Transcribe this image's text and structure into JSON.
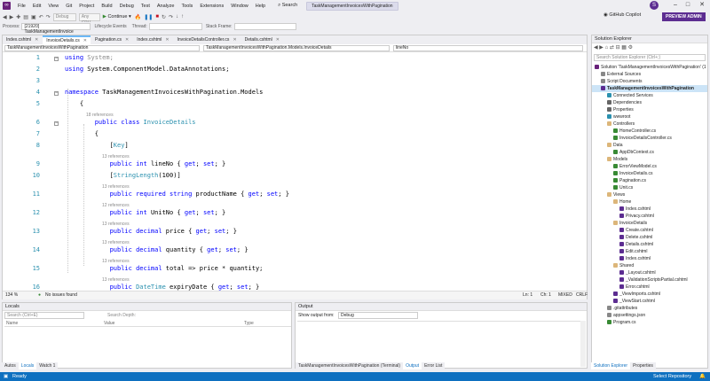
{
  "menubar": {
    "logo_icon": "visual-studio-logo-icon",
    "items": [
      "File",
      "Edit",
      "View",
      "Git",
      "Project",
      "Build",
      "Debug",
      "Test",
      "Analyze",
      "Tools",
      "Extensions",
      "Window",
      "Help"
    ],
    "search": "Search",
    "solution_name": "TaskManagementInvoicesWithPagination",
    "avatar": "S"
  },
  "toolbar": {
    "config": "Debug",
    "platform": "Any CPU",
    "run_label": "Continue",
    "copilot": "GitHub Copilot",
    "preview": "PREVIEW ADMIN"
  },
  "procbar": {
    "process_label": "Process:",
    "process_value": "[21920] TaskManagementInvoice",
    "lifecycle": "Lifecycle Events",
    "thread_label": "Thread:",
    "stack_label": "Stack Frame:"
  },
  "editor": {
    "tabs": [
      "Index.cshtml",
      "InvoiceDetails.cs",
      "Pagination.cs",
      "Index.cshtml",
      "InvoiceDetailsController.cs",
      "Details.cshtml"
    ],
    "active_tab": 1,
    "nav": [
      "TaskManagementInvoicesWithPagination",
      "TaskManagementInvoicesWithPagination.Models.InvoiceDetails",
      "lineNo"
    ],
    "lines": [
      {
        "n": "1",
        "parts": [
          [
            "kw",
            "using "
          ],
          [
            "cm",
            "System;"
          ]
        ]
      },
      {
        "n": "2",
        "parts": [
          [
            "kw",
            "using "
          ],
          [
            "",
            "System.ComponentModel.DataAnnotations;"
          ]
        ]
      },
      {
        "n": "3",
        "parts": []
      },
      {
        "n": "4",
        "parts": [
          [
            "kw",
            "namespace "
          ],
          [
            "",
            "TaskManagementInvoicesWithPagination.Models"
          ]
        ]
      },
      {
        "n": "5",
        "parts": [
          [
            "",
            "    {"
          ]
        ]
      },
      {
        "n": "",
        "ref": "18 references"
      },
      {
        "n": "6",
        "parts": [
          [
            "kw",
            "        public class "
          ],
          [
            "ty",
            "InvoiceDetails"
          ]
        ]
      },
      {
        "n": "7",
        "parts": [
          [
            "",
            "        {"
          ]
        ]
      },
      {
        "n": "8",
        "parts": [
          [
            "",
            "            ["
          ],
          [
            "ty",
            "Key"
          ],
          [
            "",
            "]"
          ]
        ]
      },
      {
        "n": "",
        "ref": "13 references"
      },
      {
        "n": "9",
        "parts": [
          [
            "kw",
            "            public int "
          ],
          [
            "",
            "lineNo { "
          ],
          [
            "kw",
            "get"
          ],
          [
            "",
            "; "
          ],
          [
            "kw",
            "set"
          ],
          [
            "",
            "; }"
          ]
        ]
      },
      {
        "n": "10",
        "parts": [
          [
            "",
            "            ["
          ],
          [
            "ty",
            "StringLength"
          ],
          [
            "",
            "(100)]"
          ]
        ]
      },
      {
        "n": "",
        "ref": "13 references"
      },
      {
        "n": "11",
        "parts": [
          [
            "kw",
            "            public required string "
          ],
          [
            "",
            "productName { "
          ],
          [
            "kw",
            "get"
          ],
          [
            "",
            "; "
          ],
          [
            "kw",
            "set"
          ],
          [
            "",
            "; }"
          ]
        ]
      },
      {
        "n": "",
        "ref": "12 references"
      },
      {
        "n": "12",
        "parts": [
          [
            "kw",
            "            public int "
          ],
          [
            "",
            "UnitNo { "
          ],
          [
            "kw",
            "get"
          ],
          [
            "",
            "; "
          ],
          [
            "kw",
            "set"
          ],
          [
            "",
            "; }"
          ]
        ]
      },
      {
        "n": "",
        "ref": "13 references"
      },
      {
        "n": "13",
        "parts": [
          [
            "kw",
            "            public decimal "
          ],
          [
            "",
            "price { "
          ],
          [
            "kw",
            "get"
          ],
          [
            "",
            "; "
          ],
          [
            "kw",
            "set"
          ],
          [
            "",
            "; }"
          ]
        ]
      },
      {
        "n": "",
        "ref": "13 references"
      },
      {
        "n": "14",
        "parts": [
          [
            "kw",
            "            public decimal "
          ],
          [
            "",
            "quantity { "
          ],
          [
            "kw",
            "get"
          ],
          [
            "",
            "; "
          ],
          [
            "kw",
            "set"
          ],
          [
            "",
            "; }"
          ]
        ]
      },
      {
        "n": "",
        "ref": "13 references"
      },
      {
        "n": "15",
        "parts": [
          [
            "kw",
            "            public decimal "
          ],
          [
            "",
            "total => price * quantity;"
          ]
        ]
      },
      {
        "n": "",
        "ref": "13 references"
      },
      {
        "n": "16",
        "parts": [
          [
            "kw",
            "            public "
          ],
          [
            "ty",
            "DateTime "
          ],
          [
            "",
            "expiryDate { "
          ],
          [
            "kw",
            "get"
          ],
          [
            "",
            "; "
          ],
          [
            "kw",
            "set"
          ],
          [
            "",
            "; }"
          ]
        ]
      },
      {
        "n": "17",
        "parts": []
      },
      {
        "n": "18",
        "parts": [
          [
            "",
            "        }"
          ]
        ]
      },
      {
        "n": "19",
        "parts": [
          [
            "",
            "    }"
          ]
        ]
      },
      {
        "n": "20",
        "parts": []
      }
    ],
    "status": {
      "zoom": "134 %",
      "issues": "No issues found",
      "ln": "Ln: 1",
      "ch": "Ch: 1",
      "enc": "MIXED",
      "eol": "CRLF"
    }
  },
  "locals": {
    "title": "Locals",
    "search_placeholder": "Search (Ctrl+E)",
    "search_depth": "Search Depth:",
    "columns": [
      "Name",
      "Value",
      "Type"
    ],
    "tabs": [
      "Autos",
      "Locals",
      "Watch 1"
    ]
  },
  "output": {
    "title": "Output",
    "show_from": "Show output from:",
    "source": "Debug",
    "tabs": [
      "TaskManagementInvoicesWithPagination (Terminal)",
      "Output",
      "Error List"
    ]
  },
  "solution_explorer": {
    "title": "Solution Explorer",
    "search_placeholder": "Search Solution Explorer (Ctrl+;)",
    "items": [
      {
        "label": "Solution 'TaskManagementInvoicesWithPagination' (1",
        "lvl": 0,
        "c": "#68217a"
      },
      {
        "label": "External Sources",
        "lvl": 1,
        "c": "#888"
      },
      {
        "label": "Script Documents",
        "lvl": 1,
        "c": "#888"
      },
      {
        "label": "TaskManagementInvoicesWithPagination",
        "lvl": 1,
        "c": "#5c2d91",
        "sel": true
      },
      {
        "label": "Connected Services",
        "lvl": 2,
        "c": "#2b91af"
      },
      {
        "label": "Dependencies",
        "lvl": 2,
        "c": "#666"
      },
      {
        "label": "Properties",
        "lvl": 2,
        "c": "#666"
      },
      {
        "label": "wwwroot",
        "lvl": 2,
        "c": "#2b91af"
      },
      {
        "label": "Controllers",
        "lvl": 2,
        "c": "#dcb67a"
      },
      {
        "label": "HomeController.cs",
        "lvl": 3,
        "c": "#388a34"
      },
      {
        "label": "InvoiceDetailsController.cs",
        "lvl": 3,
        "c": "#388a34"
      },
      {
        "label": "Data",
        "lvl": 2,
        "c": "#dcb67a"
      },
      {
        "label": "AppDbContext.cs",
        "lvl": 3,
        "c": "#388a34"
      },
      {
        "label": "Models",
        "lvl": 2,
        "c": "#dcb67a"
      },
      {
        "label": "ErrorViewModel.cs",
        "lvl": 3,
        "c": "#388a34"
      },
      {
        "label": "InvoiceDetails.cs",
        "lvl": 3,
        "c": "#388a34"
      },
      {
        "label": "Pagination.cs",
        "lvl": 3,
        "c": "#388a34"
      },
      {
        "label": "Unit.cs",
        "lvl": 3,
        "c": "#388a34"
      },
      {
        "label": "Views",
        "lvl": 2,
        "c": "#dcb67a"
      },
      {
        "label": "Home",
        "lvl": 3,
        "c": "#dcb67a"
      },
      {
        "label": "Index.cshtml",
        "lvl": 4,
        "c": "#5c2d91"
      },
      {
        "label": "Privacy.cshtml",
        "lvl": 4,
        "c": "#5c2d91"
      },
      {
        "label": "InvoiceDetails",
        "lvl": 3,
        "c": "#dcb67a"
      },
      {
        "label": "Create.cshtml",
        "lvl": 4,
        "c": "#5c2d91"
      },
      {
        "label": "Delete.cshtml",
        "lvl": 4,
        "c": "#5c2d91"
      },
      {
        "label": "Details.cshtml",
        "lvl": 4,
        "c": "#5c2d91"
      },
      {
        "label": "Edit.cshtml",
        "lvl": 4,
        "c": "#5c2d91"
      },
      {
        "label": "Index.cshtml",
        "lvl": 4,
        "c": "#5c2d91"
      },
      {
        "label": "Shared",
        "lvl": 3,
        "c": "#dcb67a"
      },
      {
        "label": "_Layout.cshtml",
        "lvl": 4,
        "c": "#5c2d91"
      },
      {
        "label": "_ValidationScriptsPartial.cshtml",
        "lvl": 4,
        "c": "#5c2d91"
      },
      {
        "label": "Error.cshtml",
        "lvl": 4,
        "c": "#5c2d91"
      },
      {
        "label": "_ViewImports.cshtml",
        "lvl": 3,
        "c": "#5c2d91"
      },
      {
        "label": "_ViewStart.cshtml",
        "lvl": 3,
        "c": "#5c2d91"
      },
      {
        "label": ".gitattributes",
        "lvl": 2,
        "c": "#888"
      },
      {
        "label": "appsettings.json",
        "lvl": 2,
        "c": "#888"
      },
      {
        "label": "Program.cs",
        "lvl": 2,
        "c": "#388a34"
      }
    ],
    "tabs": [
      "Solution Explorer",
      "Properties"
    ]
  },
  "statusbar": {
    "left": "Ready",
    "right": "Select Repository"
  }
}
